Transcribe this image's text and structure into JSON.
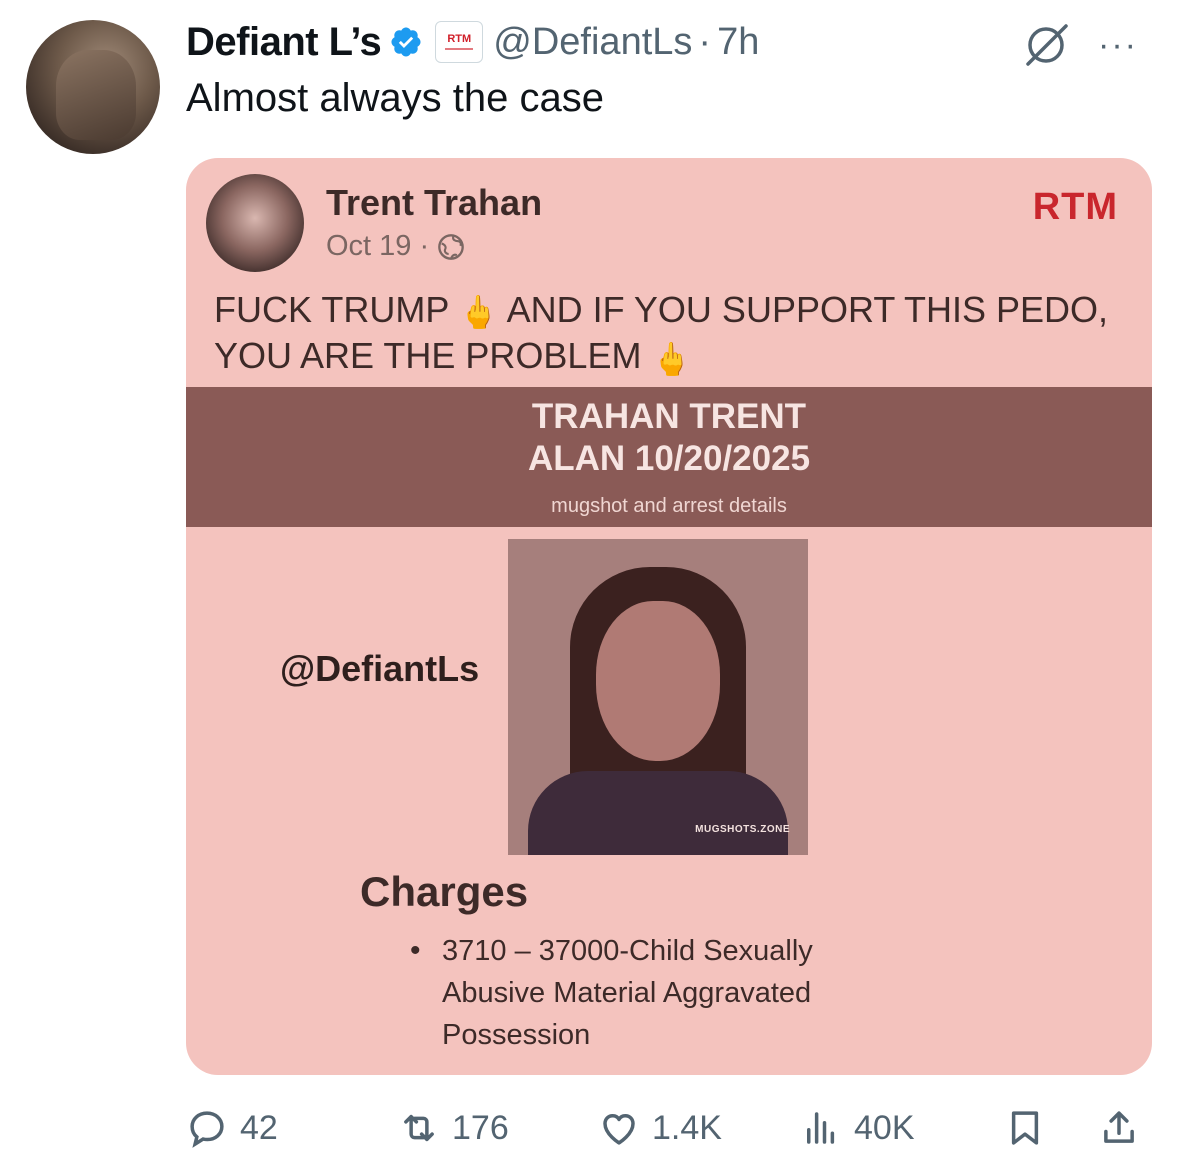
{
  "tweet": {
    "display_name": "Defiant L’s",
    "affiliate_badge": "RTM",
    "handle": "@DefiantLs",
    "separator": "·",
    "time": "7h",
    "more": "···",
    "text": "Almost always the case"
  },
  "media": {
    "fb_name": "Trent Trahan",
    "fb_date": "Oct 19 ·",
    "brand": "RTM",
    "post_part1": "FUCK TRUMP",
    "post_hand": "🖕",
    "post_part2": " AND IF YOU SUPPORT THIS PEDO, YOU ARE THE PROBLEM",
    "banner_line1": "TRAHAN TRENT",
    "banner_line2": "ALAN 10/20/2025",
    "banner_sub": "mugshot and arrest details",
    "watermark": "@DefiantLs",
    "mugshot_tag": "MUGSHOTS.ZONE",
    "charges_title": "Charges",
    "charge_item": "3710 – 37000-Child Sexually Abusive Material Aggravated Possession"
  },
  "actions": {
    "replies": "42",
    "reposts": "176",
    "likes": "1.4K",
    "views": "40K"
  },
  "colors": {
    "verified": "#1d9bf0",
    "brand_red": "#c9262d",
    "media_bg": "#f4c3be",
    "banner_bg": "#8a5a56",
    "muted": "#536471"
  }
}
